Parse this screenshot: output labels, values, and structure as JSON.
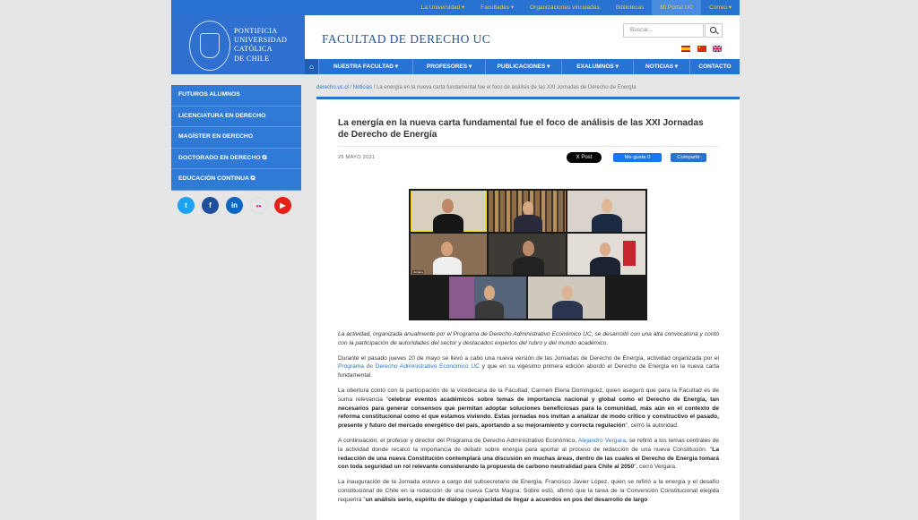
{
  "topnav": [
    "La Universidad ▾",
    "Facultades ▾",
    "Organizaciones vinculadas",
    "Bibliotecas",
    "Mi Portal UC",
    "Correo ▾"
  ],
  "logo": {
    "line1": "PONTIFICIA",
    "line2": "UNIVERSIDAD",
    "line3": "CATÓLICA",
    "line4": "DE CHILE"
  },
  "header": {
    "faculty": "FACULTAD DE DERECHO UC",
    "search_placeholder": "Buscar..."
  },
  "nav": [
    "NUESTRA FACULTAD ▾",
    "PROFESORES ▾",
    "PUBLICACIONES ▾",
    "EXALUMNOS ▾",
    "NOTICIAS ▾",
    "CONTACTO"
  ],
  "sidebar": [
    "FUTUROS ALUMNOS",
    "LICENCIATURA EN DERECHO",
    "MAGÍSTER EN DERECHO",
    "DOCTORADO EN DERECHO ⧉",
    "EDUCACIÓN CONTINUA ⧉"
  ],
  "social": [
    {
      "icon": "twitter-icon",
      "glyph": "t",
      "color": "#1da1f2"
    },
    {
      "icon": "facebook-icon",
      "glyph": "f",
      "color": "#1f4e9a"
    },
    {
      "icon": "linkedin-icon",
      "glyph": "in",
      "color": "#0a66c2"
    },
    {
      "icon": "flickr-icon",
      "glyph": "••",
      "color": "#e6e6e6"
    },
    {
      "icon": "youtube-icon",
      "glyph": "▶",
      "color": "#e62117"
    }
  ],
  "breadcrumb": {
    "home": "derecho.uc.cl",
    "sep": " / ",
    "section": "Noticias",
    "current": "La energía en la nueva carta fundamental fue el foco de análisis de las XXI Jornadas de Derecho de Energía"
  },
  "article": {
    "title": "La energía en la nueva carta fundamental fue el foco de análisis de las XXI Jornadas de Derecho de Energía",
    "date": "25 MAYO 2021",
    "x_post": "X Post",
    "fb_like": "Me gusta 0",
    "share": "Compartir",
    "caption": "La actividad, organizada anualmente por el Programa de Derecho Administrativo Económico UC, se desarrolló con una alta convocatoria y contó con la participación de autoridades del sector y destacados expertos del rubro y del mundo académico.",
    "p1_a": "Durante el pasado jueves 20 de mayo se llevó a cabo una nueva versión de las Jornadas de Derecho de Energía, actividad organizada por el ",
    "p1_link": "Programa de Derecho Administrativo Económico UC",
    "p1_b": " y que en su vigésimo primera edición abordó el Derecho de Energía en la nueva carta fundamental.",
    "p2_a": "La obertura contó con la participación de la vicedecana de la Facultad, Carmen Elena Domínguez, quien aseguró que para la Facultad es de suma relevancia \"",
    "p2_bold": "celebrar eventos académicos sobre temas de importancia nacional y global como el Derecho de Energía, tan necesarios para generar consensos que permitan adoptar soluciones beneficiosas para la comunidad, más aún en el contexto de reforma constitucional como el que estamos viviendo. Estas jornadas nos invitan a analizar de modo crítico y constructivo el pasado, presente y futuro del mercado energético del país, aportando a su mejoramiento y correcta regulación",
    "p2_b": "\", cerró la autoridad.",
    "p3_a": "A continuación, el profesor y director del Programa de Derecho Administrativo Económico, ",
    "p3_link": "Alejandro Vergara",
    "p3_b": ", se refirió a los temas centrales de la actividad donde recalcó la importancia de debatir sobre energía para aportar al proceso de redacción de una nueva Constitución. \"",
    "p3_bold": "La redacción de una nueva Constitución contemplará una discusión en muchas áreas, dentro de las cuales el Derecho de Energía tomará con toda seguridad un rol relevante considerando la propuesta de carbono neutralidad para Chile al 2050",
    "p3_c": "\", cerró Vergara.",
    "p4_a": "La inauguración de la Jornada estuvo a cargo del subsecretario de Energía, Francisco Javier López, quien se refirió a la energía y el desafío constitucional de Chile en la redacción de una nueva Carta Magna. Sobre esto, afirmó que la tarea de la Convención Constitucional elegida requerirá \"",
    "p4_bold": "un análisis serio, espíritu de diálogo y capacidad de llegar a acuerdos en pos del desarrollo de largo"
  }
}
